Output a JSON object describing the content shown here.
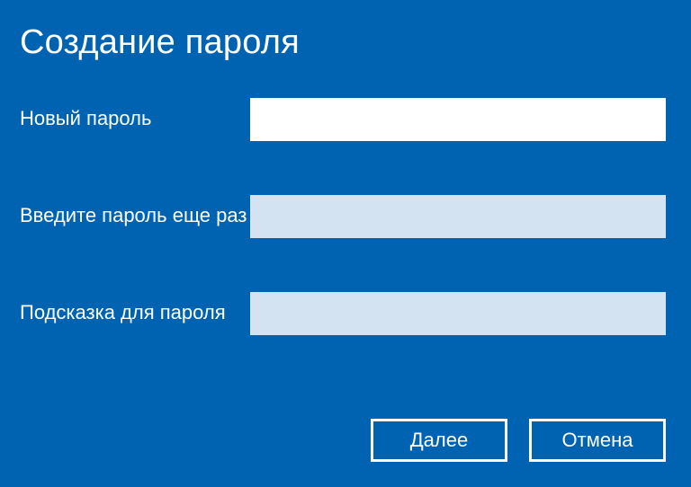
{
  "title": "Создание пароля",
  "fields": {
    "new_password": {
      "label": "Новый пароль",
      "value": ""
    },
    "confirm_password": {
      "label": "Введите пароль еще раз",
      "value": ""
    },
    "hint": {
      "label": "Подсказка для пароля",
      "value": ""
    }
  },
  "buttons": {
    "next": "Далее",
    "cancel": "Отмена"
  }
}
